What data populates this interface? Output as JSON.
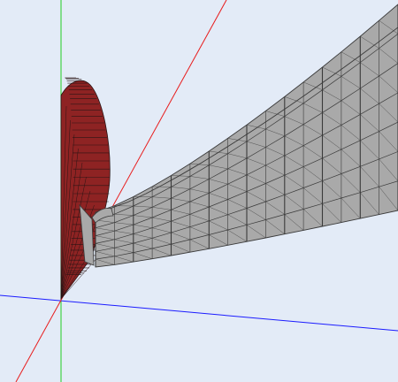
{
  "viewport": {
    "background_color": "#e3ebf7"
  },
  "axes": {
    "x_axis": {
      "color": "#1b1bff",
      "label": ""
    },
    "y_axis": {
      "color": "#22cc22",
      "label": ""
    },
    "z_axis": {
      "color": "#e81c1c",
      "label": ""
    }
  },
  "objects": [
    {
      "name": "red-half-disc",
      "fill_color": "#8e2323",
      "edge_color": "#2a1414"
    },
    {
      "name": "gray-curved-sweep",
      "fill_color": "#a9a9a9",
      "edge_color": "#3a3a3a"
    }
  ]
}
